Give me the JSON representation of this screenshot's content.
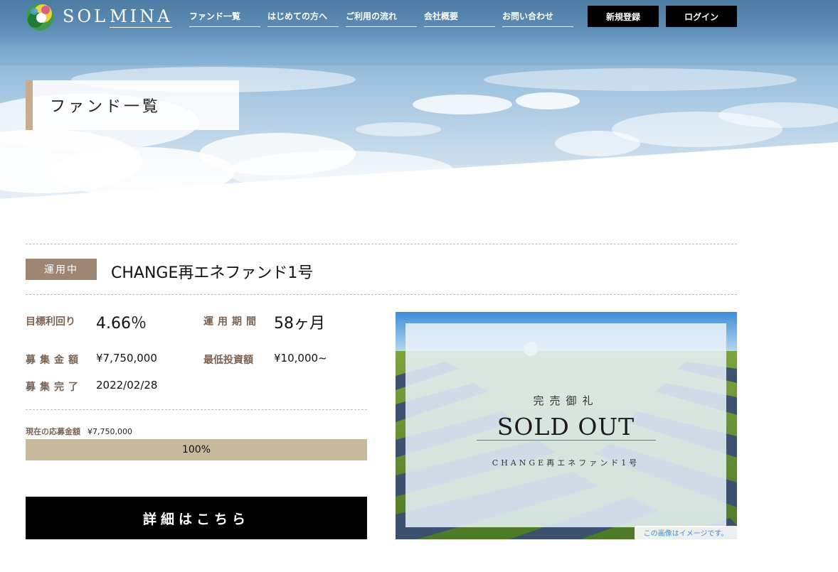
{
  "brand": {
    "logo_primary": "SOL",
    "logo_secondary": "MINA"
  },
  "nav": {
    "items": [
      {
        "label": "ファンド一覧"
      },
      {
        "label": "はじめての方へ"
      },
      {
        "label": "ご利用の流れ"
      },
      {
        "label": "会社概要"
      },
      {
        "label": "お問い合わせ"
      }
    ],
    "register_label": "新規登録",
    "login_label": "ログイン"
  },
  "page": {
    "title": "ファンド一覧"
  },
  "fund": {
    "status": "運用中",
    "name": "CHANGE再エネファンド1号",
    "target_yield_label": "目標利回り",
    "target_yield": "4.66％",
    "period_label": "運用期間",
    "period": "58ヶ月",
    "raise_amount_label": "募集金額",
    "raise_amount": "¥7,750,000",
    "min_invest_label": "最低投資額",
    "min_invest": "¥10,000~",
    "raise_end_label": "募集完了",
    "raise_end": "2022/02/28",
    "current_label": "現在の応募金額",
    "current_amount": "¥7,750,000",
    "progress": 1.0,
    "progress_text": "100%",
    "detail_button": "詳細はこちら",
    "image": {
      "sold_jp": "完売御礼",
      "sold_en": "SOLD OUT",
      "sold_fund": "CHANGE再エネファンド1号",
      "note": "この画像はイメージです。"
    }
  },
  "colors": {
    "accent": "#9e8672",
    "label": "#7a6352",
    "progress_fill": "#c7b99c",
    "progress_track": "#e6ddd0",
    "title_bar": "#c9ab8e"
  }
}
